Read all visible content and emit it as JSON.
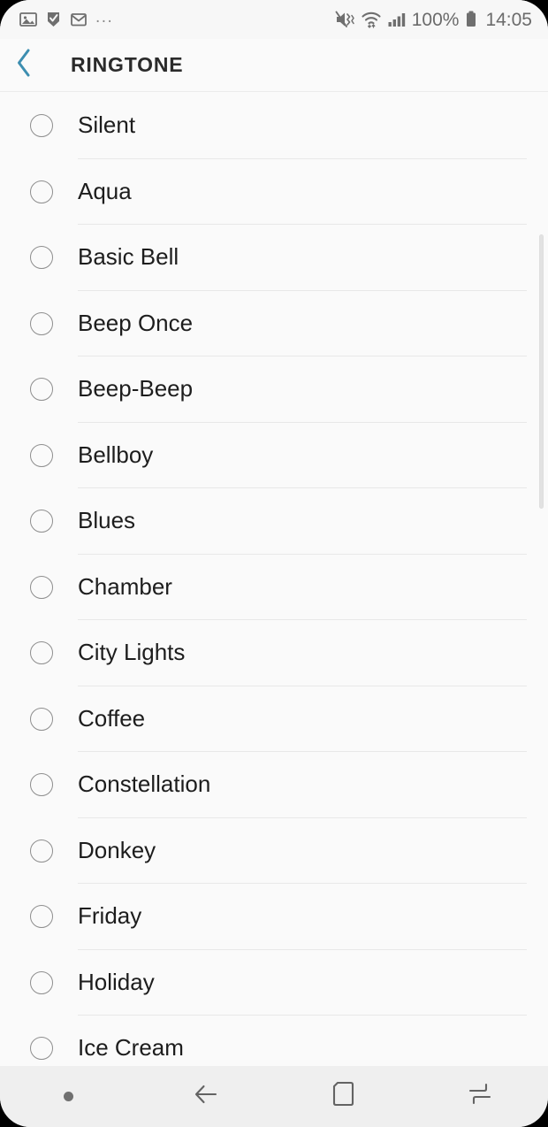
{
  "status_bar": {
    "left_icons": [
      {
        "name": "gallery-image-icon",
        "label": "image"
      },
      {
        "name": "checkmark-flag-icon",
        "label": "flag"
      },
      {
        "name": "email-envelope-icon",
        "label": "email"
      }
    ],
    "overflow": "...",
    "right_icons": [
      {
        "name": "mute-vibrate-icon",
        "label": "sound off"
      },
      {
        "name": "wifi-icon",
        "label": "wifi"
      },
      {
        "name": "cellular-signal-icon",
        "label": "signal"
      }
    ],
    "battery_percent": "100%",
    "time": "14:05"
  },
  "header": {
    "title": "RINGTONE",
    "back_icon": "chevron-left-icon",
    "back_accent_color": "#3d8eb0"
  },
  "list": {
    "selected_index": -1,
    "items": [
      {
        "label": "Silent",
        "selected": false
      },
      {
        "label": "Aqua",
        "selected": false
      },
      {
        "label": "Basic Bell",
        "selected": false
      },
      {
        "label": "Beep Once",
        "selected": false
      },
      {
        "label": "Beep-Beep",
        "selected": false
      },
      {
        "label": "Bellboy",
        "selected": false
      },
      {
        "label": "Blues",
        "selected": false
      },
      {
        "label": "Chamber",
        "selected": false
      },
      {
        "label": "City Lights",
        "selected": false
      },
      {
        "label": "Coffee",
        "selected": false
      },
      {
        "label": "Constellation",
        "selected": false
      },
      {
        "label": "Donkey",
        "selected": false
      },
      {
        "label": "Friday",
        "selected": false
      },
      {
        "label": "Holiday",
        "selected": false
      },
      {
        "label": "Ice Cream",
        "selected": false
      }
    ]
  },
  "nav_bar": {
    "buttons": [
      {
        "name": "keyboard-hide-dot",
        "label": "hide"
      },
      {
        "name": "back-arrow-icon",
        "label": "Back"
      },
      {
        "name": "home-square-icon",
        "label": "Home"
      },
      {
        "name": "recents-icon",
        "label": "Recents"
      }
    ]
  },
  "colors": {
    "background": "#fafafa",
    "divider": "#e8e8e8",
    "text": "#1d1d1d",
    "accent": "#3d8eb0",
    "nav_background": "#efefef"
  }
}
